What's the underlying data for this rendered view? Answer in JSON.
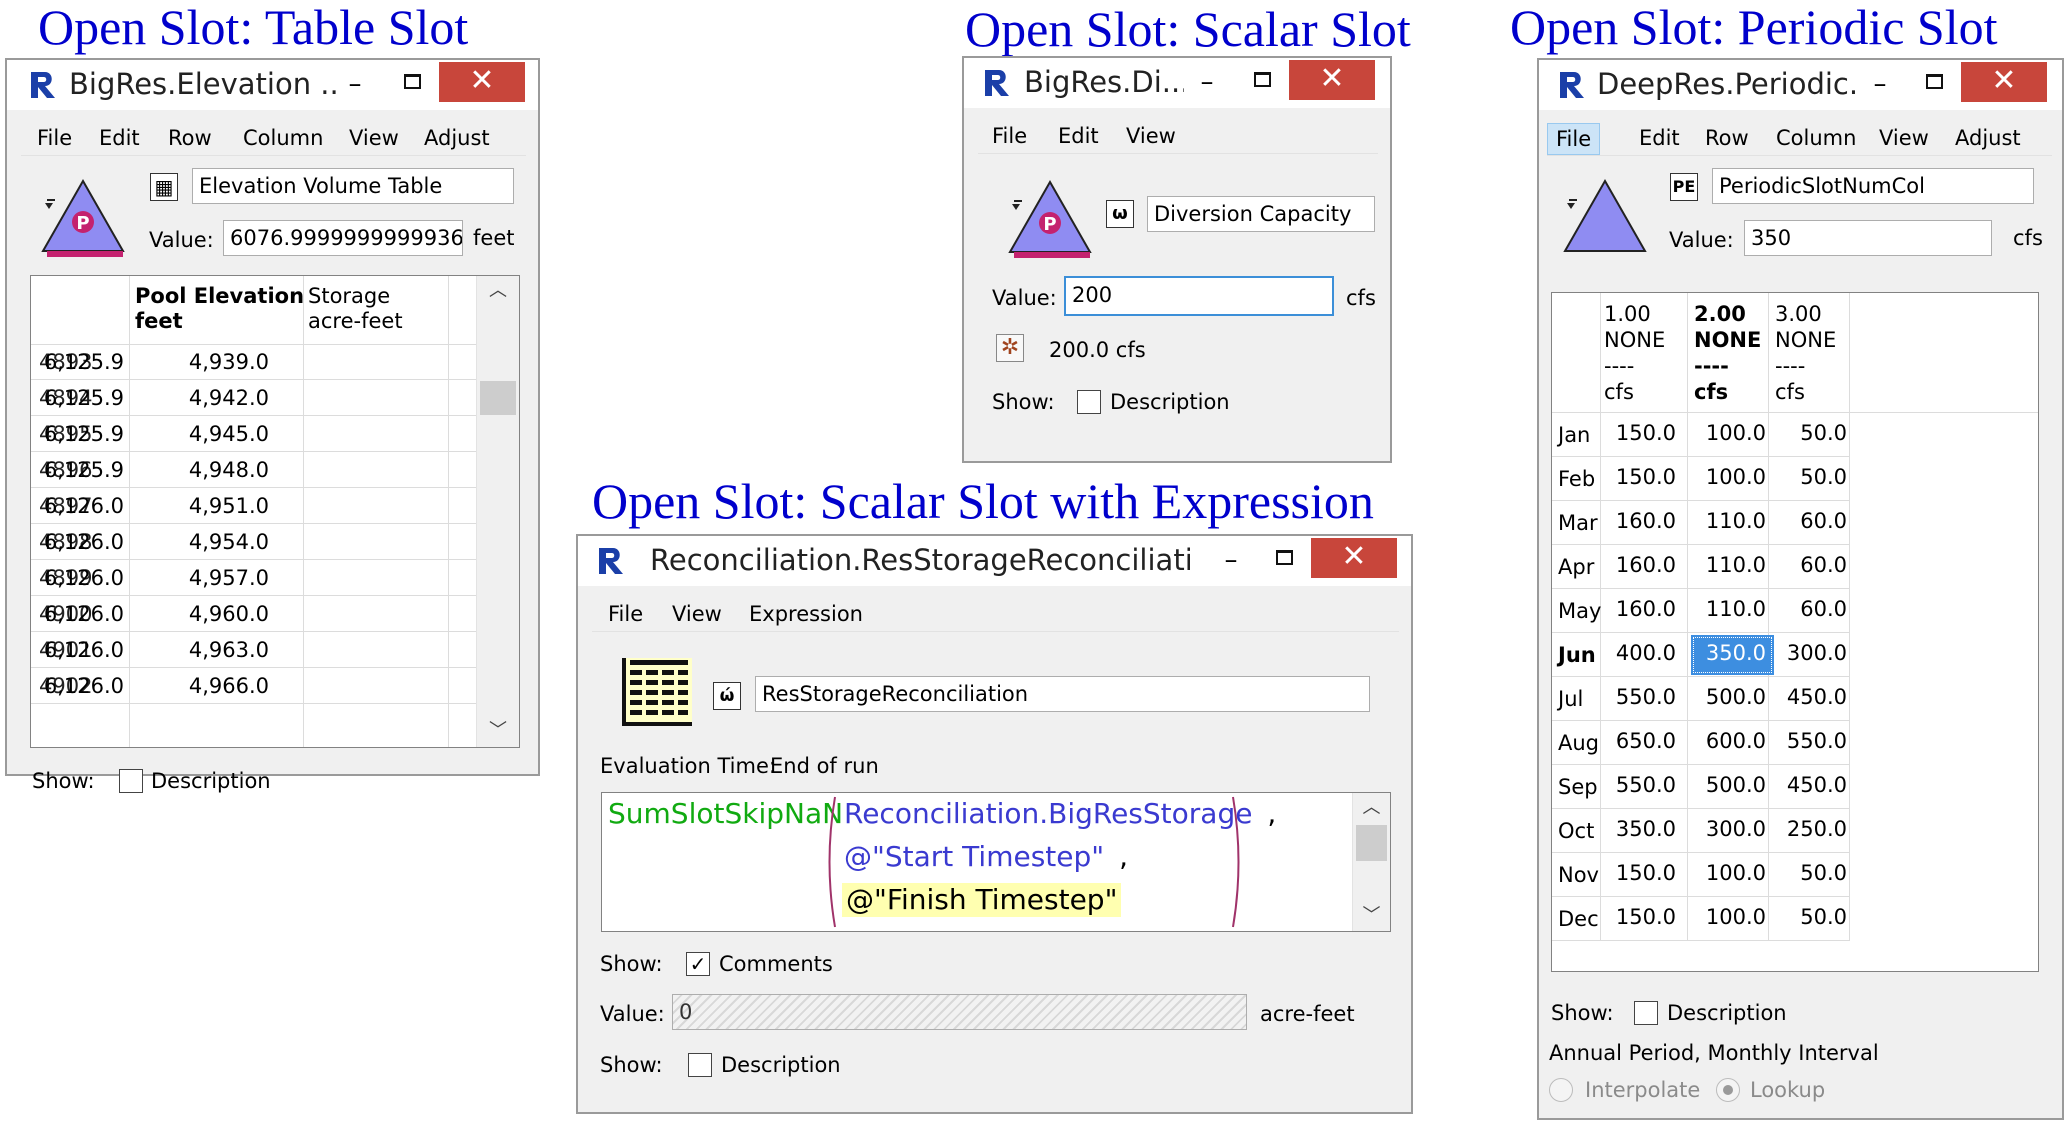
{
  "captions": {
    "table": "Open Slot: Table Slot",
    "scalar": "Open Slot: Scalar Slot",
    "periodic": "Open Slot: Periodic Slot",
    "expression": "Open Slot: Scalar Slot with Expression"
  },
  "colors": {
    "caption": "#0000cc",
    "close_button": "#c8463b",
    "app_icon": "#1b3fa8",
    "reservoir_fill": "#8f8cf2",
    "reservoir_base": "#c4226f",
    "function_name": "#11aa11",
    "expression_text": "#3a3ad0",
    "highlight": "#ffffb0",
    "selected_cell": "#3d8ee0"
  },
  "table_window": {
    "title": "BigRes.Elevation ...",
    "menu": [
      "File",
      "Edit",
      "Row",
      "Column",
      "View",
      "Adjust"
    ],
    "slot_icon": "table-grid-icon",
    "slot_name": "Elevation Volume Table",
    "value_label": "Value:",
    "value": "6076.9999999999936",
    "unit": "feet",
    "columns": [
      {
        "name": "Pool Elevation",
        "unit": "feet"
      },
      {
        "name": "Storage",
        "unit": "acre-feet"
      }
    ],
    "rows": [
      {
        "index": "4893",
        "elevation": "6,125.9",
        "storage": "4,939.0"
      },
      {
        "index": "4894",
        "elevation": "6,125.9",
        "storage": "4,942.0"
      },
      {
        "index": "4895",
        "elevation": "6,125.9",
        "storage": "4,945.0"
      },
      {
        "index": "4896",
        "elevation": "6,125.9",
        "storage": "4,948.0"
      },
      {
        "index": "4897",
        "elevation": "6,126.0",
        "storage": "4,951.0"
      },
      {
        "index": "4898",
        "elevation": "6,126.0",
        "storage": "4,954.0"
      },
      {
        "index": "4899",
        "elevation": "6,126.0",
        "storage": "4,957.0"
      },
      {
        "index": "4900",
        "elevation": "6,126.0",
        "storage": "4,960.0"
      },
      {
        "index": "4901",
        "elevation": "6,126.0",
        "storage": "4,963.0"
      },
      {
        "index": "4902",
        "elevation": "6,126.0",
        "storage": "4,966.0"
      }
    ],
    "show_label": "Show:",
    "description_label": "Description",
    "description_checked": false
  },
  "scalar_window": {
    "title": "BigRes.Di...",
    "menu": [
      "File",
      "Edit",
      "View"
    ],
    "slot_icon": "scalar-slot-icon",
    "slot_name": "Diversion Capacity",
    "value_label": "Value:",
    "value_input": "200",
    "unit": "cfs",
    "status_icon": "gear-icon",
    "status_value": "200.0 cfs",
    "show_label": "Show:",
    "description_label": "Description",
    "description_checked": false
  },
  "expression_window": {
    "title": "Reconciliation.ResStorageReconciliation",
    "menu": [
      "File",
      "View",
      "Expression"
    ],
    "slot_icon": "expression-slot-icon",
    "slot_name": "ResStorageReconciliation",
    "eval_time_label": "Evaluation Time:",
    "eval_time_value": "End of run",
    "expression": {
      "function": "SumSlotSkipNaN",
      "arg1": "Reconciliation.BigResStorage",
      "arg2": "@\"Start Timestep\"",
      "arg3": "@\"Finish Timestep\"",
      "comma": ","
    },
    "show_label": "Show:",
    "comments_label": "Comments",
    "comments_checked": true,
    "value_label": "Value:",
    "value": "0",
    "unit": "acre-feet",
    "description_label": "Description",
    "description_checked": false
  },
  "periodic_window": {
    "title": "DeepRes.Periodic...",
    "menu": [
      "File",
      "Edit",
      "Row",
      "Column",
      "View",
      "Adjust"
    ],
    "active_menu": "File",
    "slot_icon": "periodic-slot-icon",
    "slot_name": "PeriodicSlotNumCol",
    "value_label": "Value:",
    "value": "350",
    "unit": "cfs",
    "columns": [
      {
        "value": "1.00",
        "qual": "NONE",
        "sep": "----",
        "unit": "cfs",
        "bold": false
      },
      {
        "value": "2.00",
        "qual": "NONE",
        "sep": "----",
        "unit": "cfs",
        "bold": true
      },
      {
        "value": "3.00",
        "qual": "NONE",
        "sep": "----",
        "unit": "cfs",
        "bold": false
      }
    ],
    "rows": [
      {
        "month": "Jan",
        "values": [
          "150.0",
          "100.0",
          "50.0"
        ]
      },
      {
        "month": "Feb",
        "values": [
          "150.0",
          "100.0",
          "50.0"
        ]
      },
      {
        "month": "Mar",
        "values": [
          "160.0",
          "110.0",
          "60.0"
        ]
      },
      {
        "month": "Apr",
        "values": [
          "160.0",
          "110.0",
          "60.0"
        ]
      },
      {
        "month": "May",
        "values": [
          "160.0",
          "110.0",
          "60.0"
        ]
      },
      {
        "month": "Jun",
        "values": [
          "400.0",
          "350.0",
          "300.0"
        ]
      },
      {
        "month": "Jul",
        "values": [
          "550.0",
          "500.0",
          "450.0"
        ]
      },
      {
        "month": "Aug",
        "values": [
          "650.0",
          "600.0",
          "550.0"
        ]
      },
      {
        "month": "Sep",
        "values": [
          "550.0",
          "500.0",
          "450.0"
        ]
      },
      {
        "month": "Oct",
        "values": [
          "350.0",
          "300.0",
          "250.0"
        ]
      },
      {
        "month": "Nov",
        "values": [
          "150.0",
          "100.0",
          "50.0"
        ]
      },
      {
        "month": "Dec",
        "values": [
          "150.0",
          "100.0",
          "50.0"
        ]
      }
    ],
    "selected_row": "Jun",
    "selected_col": 2,
    "show_label": "Show:",
    "description_label": "Description",
    "description_checked": false,
    "period_info": "Annual Period, Monthly Interval",
    "interpolate_label": "Interpolate",
    "lookup_label": "Lookup",
    "lookup_selected": true
  }
}
